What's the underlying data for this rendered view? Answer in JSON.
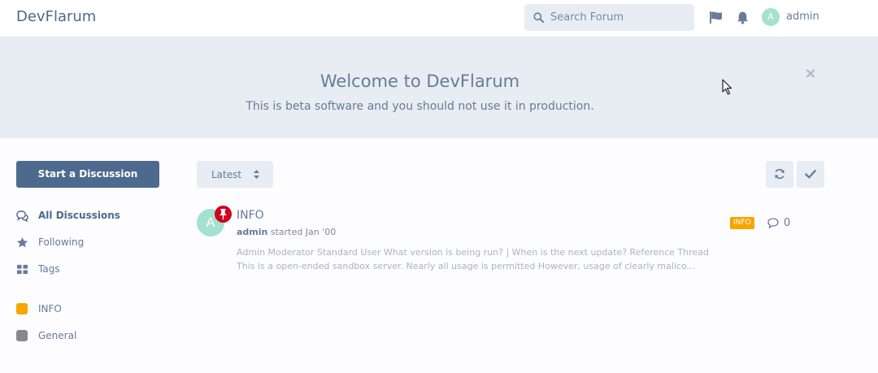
{
  "header": {
    "brand": "DevFlarum",
    "search_placeholder": "Search Forum",
    "avatar_letter": "A",
    "username": "admin"
  },
  "hero": {
    "title": "Welcome to DevFlarum",
    "subtitle": "This is beta software and you should not use it in production.",
    "close_symbol": "×"
  },
  "sidebar": {
    "start_button": "Start a Discussion",
    "nav": [
      {
        "label": "All Discussions",
        "icon": "comments-icon",
        "active": true
      },
      {
        "label": "Following",
        "icon": "star-icon",
        "active": false
      },
      {
        "label": "Tags",
        "icon": "tags-grid-icon",
        "active": false
      }
    ],
    "tags": [
      {
        "label": "INFO",
        "color": "#f7a500"
      },
      {
        "label": "General",
        "color": "#888888"
      }
    ]
  },
  "toolbar": {
    "sort_label": "Latest"
  },
  "discussions": [
    {
      "avatar_letter": "A",
      "title": "INFO",
      "author": "admin",
      "started_text": "started Jan '00",
      "excerpt": "Admin Moderator Standard User What version is being run? | When is the next update? Reference Thread This is a open-ended sandbox server. Nearly all usage is permitted However, usage of clearly malico...",
      "tag": "INFO",
      "tag_color": "#f7a500",
      "reply_count": "0",
      "pinned": true
    }
  ]
}
